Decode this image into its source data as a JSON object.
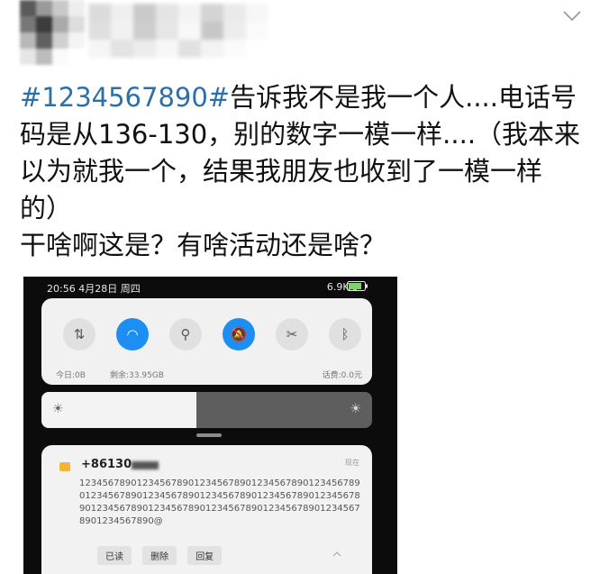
{
  "post": {
    "hashtag": "#1234567890#",
    "line1_rest": "告诉我不是我一个人....电话号",
    "line2": "码是从136-130，别的数字一模一样....（我本来",
    "line3": "以为就我一个，结果我朋友也收到了一模一样",
    "line4": "的）",
    "line5": "干啥啊这是？有啥活动还是啥？",
    "avatar_colors": [
      "#5a5a5a",
      "#9a9a9a",
      "#c9c9c9",
      "#eeeeee",
      "#777777",
      "#3c3c3c",
      "#aaaaaa",
      "#dddddd",
      "#b8b8b8",
      "#606060",
      "#d0d0d0",
      "#f4f4f4",
      "#e6e6e6",
      "#bcbcbc",
      "#fafafa",
      "#ffffff"
    ],
    "name_colors": [
      "#d8d8d8",
      "#eeeeee",
      "#c5c5c5",
      "#e2e2e2",
      "#f2f2f2",
      "#d0d0d0",
      "#e8e8e8",
      "#f6f6f6",
      "#dcdcdc",
      "#f0f0f0",
      "#c8c8c8",
      "#e4e4e4",
      "#f8f8f8",
      "#c2c2c2",
      "#ececec",
      "#fafafa",
      "#f4f4f4",
      "#e0e0e0",
      "#eaeaea",
      "#f6f6f6",
      "#dedede",
      "#f2f2f2",
      "#fafafa",
      "#ffffff"
    ]
  },
  "phone": {
    "status_time": "20:56 4月28日 周四",
    "status_speed": "6.9K/s",
    "toggles": [
      {
        "icon": "data-transfer-icon",
        "glyph": "⇅",
        "on": false
      },
      {
        "icon": "wifi-icon",
        "glyph": "◠",
        "on": true
      },
      {
        "icon": "flashlight-icon",
        "glyph": "⚲",
        "on": false
      },
      {
        "icon": "silent-bell-icon",
        "glyph": "🔕",
        "on": true
      },
      {
        "icon": "screenshot-icon",
        "glyph": "✂",
        "on": false
      },
      {
        "icon": "bluetooth-icon",
        "glyph": "ᛒ",
        "on": false
      }
    ],
    "data_today": "今日:0B",
    "data_remaining": "剩余:33.95GB",
    "balance": "话费:0.0元",
    "brightness_level": 0.47,
    "notification": {
      "sender": "+86130",
      "time": "现在",
      "body": "1234567890123456789012345678901234567890123456789012345678901234567890123456789012345678901234567890123456789012345678901234567890123456789012345678901234567890@",
      "actions": [
        "已读",
        "删除",
        "回复"
      ]
    }
  }
}
